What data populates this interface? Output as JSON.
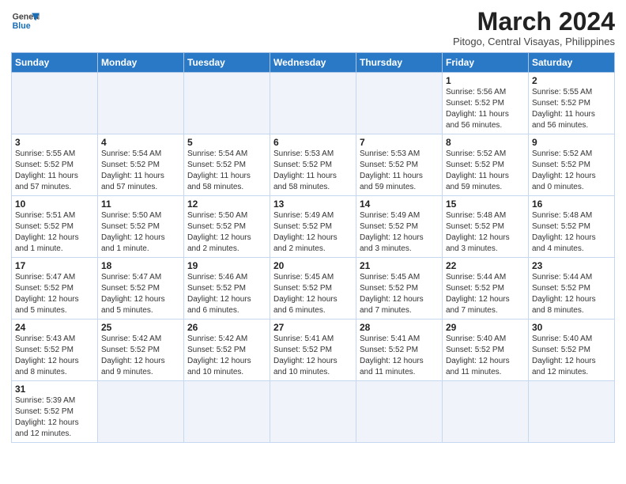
{
  "header": {
    "logo_line1": "General",
    "logo_line2": "Blue",
    "month_title": "March 2024",
    "subtitle": "Pitogo, Central Visayas, Philippines"
  },
  "weekdays": [
    "Sunday",
    "Monday",
    "Tuesday",
    "Wednesday",
    "Thursday",
    "Friday",
    "Saturday"
  ],
  "weeks": [
    [
      {
        "day": "",
        "info": ""
      },
      {
        "day": "",
        "info": ""
      },
      {
        "day": "",
        "info": ""
      },
      {
        "day": "",
        "info": ""
      },
      {
        "day": "",
        "info": ""
      },
      {
        "day": "1",
        "info": "Sunrise: 5:56 AM\nSunset: 5:52 PM\nDaylight: 11 hours\nand 56 minutes."
      },
      {
        "day": "2",
        "info": "Sunrise: 5:55 AM\nSunset: 5:52 PM\nDaylight: 11 hours\nand 56 minutes."
      }
    ],
    [
      {
        "day": "3",
        "info": "Sunrise: 5:55 AM\nSunset: 5:52 PM\nDaylight: 11 hours\nand 57 minutes."
      },
      {
        "day": "4",
        "info": "Sunrise: 5:54 AM\nSunset: 5:52 PM\nDaylight: 11 hours\nand 57 minutes."
      },
      {
        "day": "5",
        "info": "Sunrise: 5:54 AM\nSunset: 5:52 PM\nDaylight: 11 hours\nand 58 minutes."
      },
      {
        "day": "6",
        "info": "Sunrise: 5:53 AM\nSunset: 5:52 PM\nDaylight: 11 hours\nand 58 minutes."
      },
      {
        "day": "7",
        "info": "Sunrise: 5:53 AM\nSunset: 5:52 PM\nDaylight: 11 hours\nand 59 minutes."
      },
      {
        "day": "8",
        "info": "Sunrise: 5:52 AM\nSunset: 5:52 PM\nDaylight: 11 hours\nand 59 minutes."
      },
      {
        "day": "9",
        "info": "Sunrise: 5:52 AM\nSunset: 5:52 PM\nDaylight: 12 hours\nand 0 minutes."
      }
    ],
    [
      {
        "day": "10",
        "info": "Sunrise: 5:51 AM\nSunset: 5:52 PM\nDaylight: 12 hours\nand 1 minute."
      },
      {
        "day": "11",
        "info": "Sunrise: 5:50 AM\nSunset: 5:52 PM\nDaylight: 12 hours\nand 1 minute."
      },
      {
        "day": "12",
        "info": "Sunrise: 5:50 AM\nSunset: 5:52 PM\nDaylight: 12 hours\nand 2 minutes."
      },
      {
        "day": "13",
        "info": "Sunrise: 5:49 AM\nSunset: 5:52 PM\nDaylight: 12 hours\nand 2 minutes."
      },
      {
        "day": "14",
        "info": "Sunrise: 5:49 AM\nSunset: 5:52 PM\nDaylight: 12 hours\nand 3 minutes."
      },
      {
        "day": "15",
        "info": "Sunrise: 5:48 AM\nSunset: 5:52 PM\nDaylight: 12 hours\nand 3 minutes."
      },
      {
        "day": "16",
        "info": "Sunrise: 5:48 AM\nSunset: 5:52 PM\nDaylight: 12 hours\nand 4 minutes."
      }
    ],
    [
      {
        "day": "17",
        "info": "Sunrise: 5:47 AM\nSunset: 5:52 PM\nDaylight: 12 hours\nand 5 minutes."
      },
      {
        "day": "18",
        "info": "Sunrise: 5:47 AM\nSunset: 5:52 PM\nDaylight: 12 hours\nand 5 minutes."
      },
      {
        "day": "19",
        "info": "Sunrise: 5:46 AM\nSunset: 5:52 PM\nDaylight: 12 hours\nand 6 minutes."
      },
      {
        "day": "20",
        "info": "Sunrise: 5:45 AM\nSunset: 5:52 PM\nDaylight: 12 hours\nand 6 minutes."
      },
      {
        "day": "21",
        "info": "Sunrise: 5:45 AM\nSunset: 5:52 PM\nDaylight: 12 hours\nand 7 minutes."
      },
      {
        "day": "22",
        "info": "Sunrise: 5:44 AM\nSunset: 5:52 PM\nDaylight: 12 hours\nand 7 minutes."
      },
      {
        "day": "23",
        "info": "Sunrise: 5:44 AM\nSunset: 5:52 PM\nDaylight: 12 hours\nand 8 minutes."
      }
    ],
    [
      {
        "day": "24",
        "info": "Sunrise: 5:43 AM\nSunset: 5:52 PM\nDaylight: 12 hours\nand 8 minutes."
      },
      {
        "day": "25",
        "info": "Sunrise: 5:42 AM\nSunset: 5:52 PM\nDaylight: 12 hours\nand 9 minutes."
      },
      {
        "day": "26",
        "info": "Sunrise: 5:42 AM\nSunset: 5:52 PM\nDaylight: 12 hours\nand 10 minutes."
      },
      {
        "day": "27",
        "info": "Sunrise: 5:41 AM\nSunset: 5:52 PM\nDaylight: 12 hours\nand 10 minutes."
      },
      {
        "day": "28",
        "info": "Sunrise: 5:41 AM\nSunset: 5:52 PM\nDaylight: 12 hours\nand 11 minutes."
      },
      {
        "day": "29",
        "info": "Sunrise: 5:40 AM\nSunset: 5:52 PM\nDaylight: 12 hours\nand 11 minutes."
      },
      {
        "day": "30",
        "info": "Sunrise: 5:40 AM\nSunset: 5:52 PM\nDaylight: 12 hours\nand 12 minutes."
      }
    ],
    [
      {
        "day": "31",
        "info": "Sunrise: 5:39 AM\nSunset: 5:52 PM\nDaylight: 12 hours\nand 12 minutes."
      },
      {
        "day": "",
        "info": ""
      },
      {
        "day": "",
        "info": ""
      },
      {
        "day": "",
        "info": ""
      },
      {
        "day": "",
        "info": ""
      },
      {
        "day": "",
        "info": ""
      },
      {
        "day": "",
        "info": ""
      }
    ]
  ]
}
